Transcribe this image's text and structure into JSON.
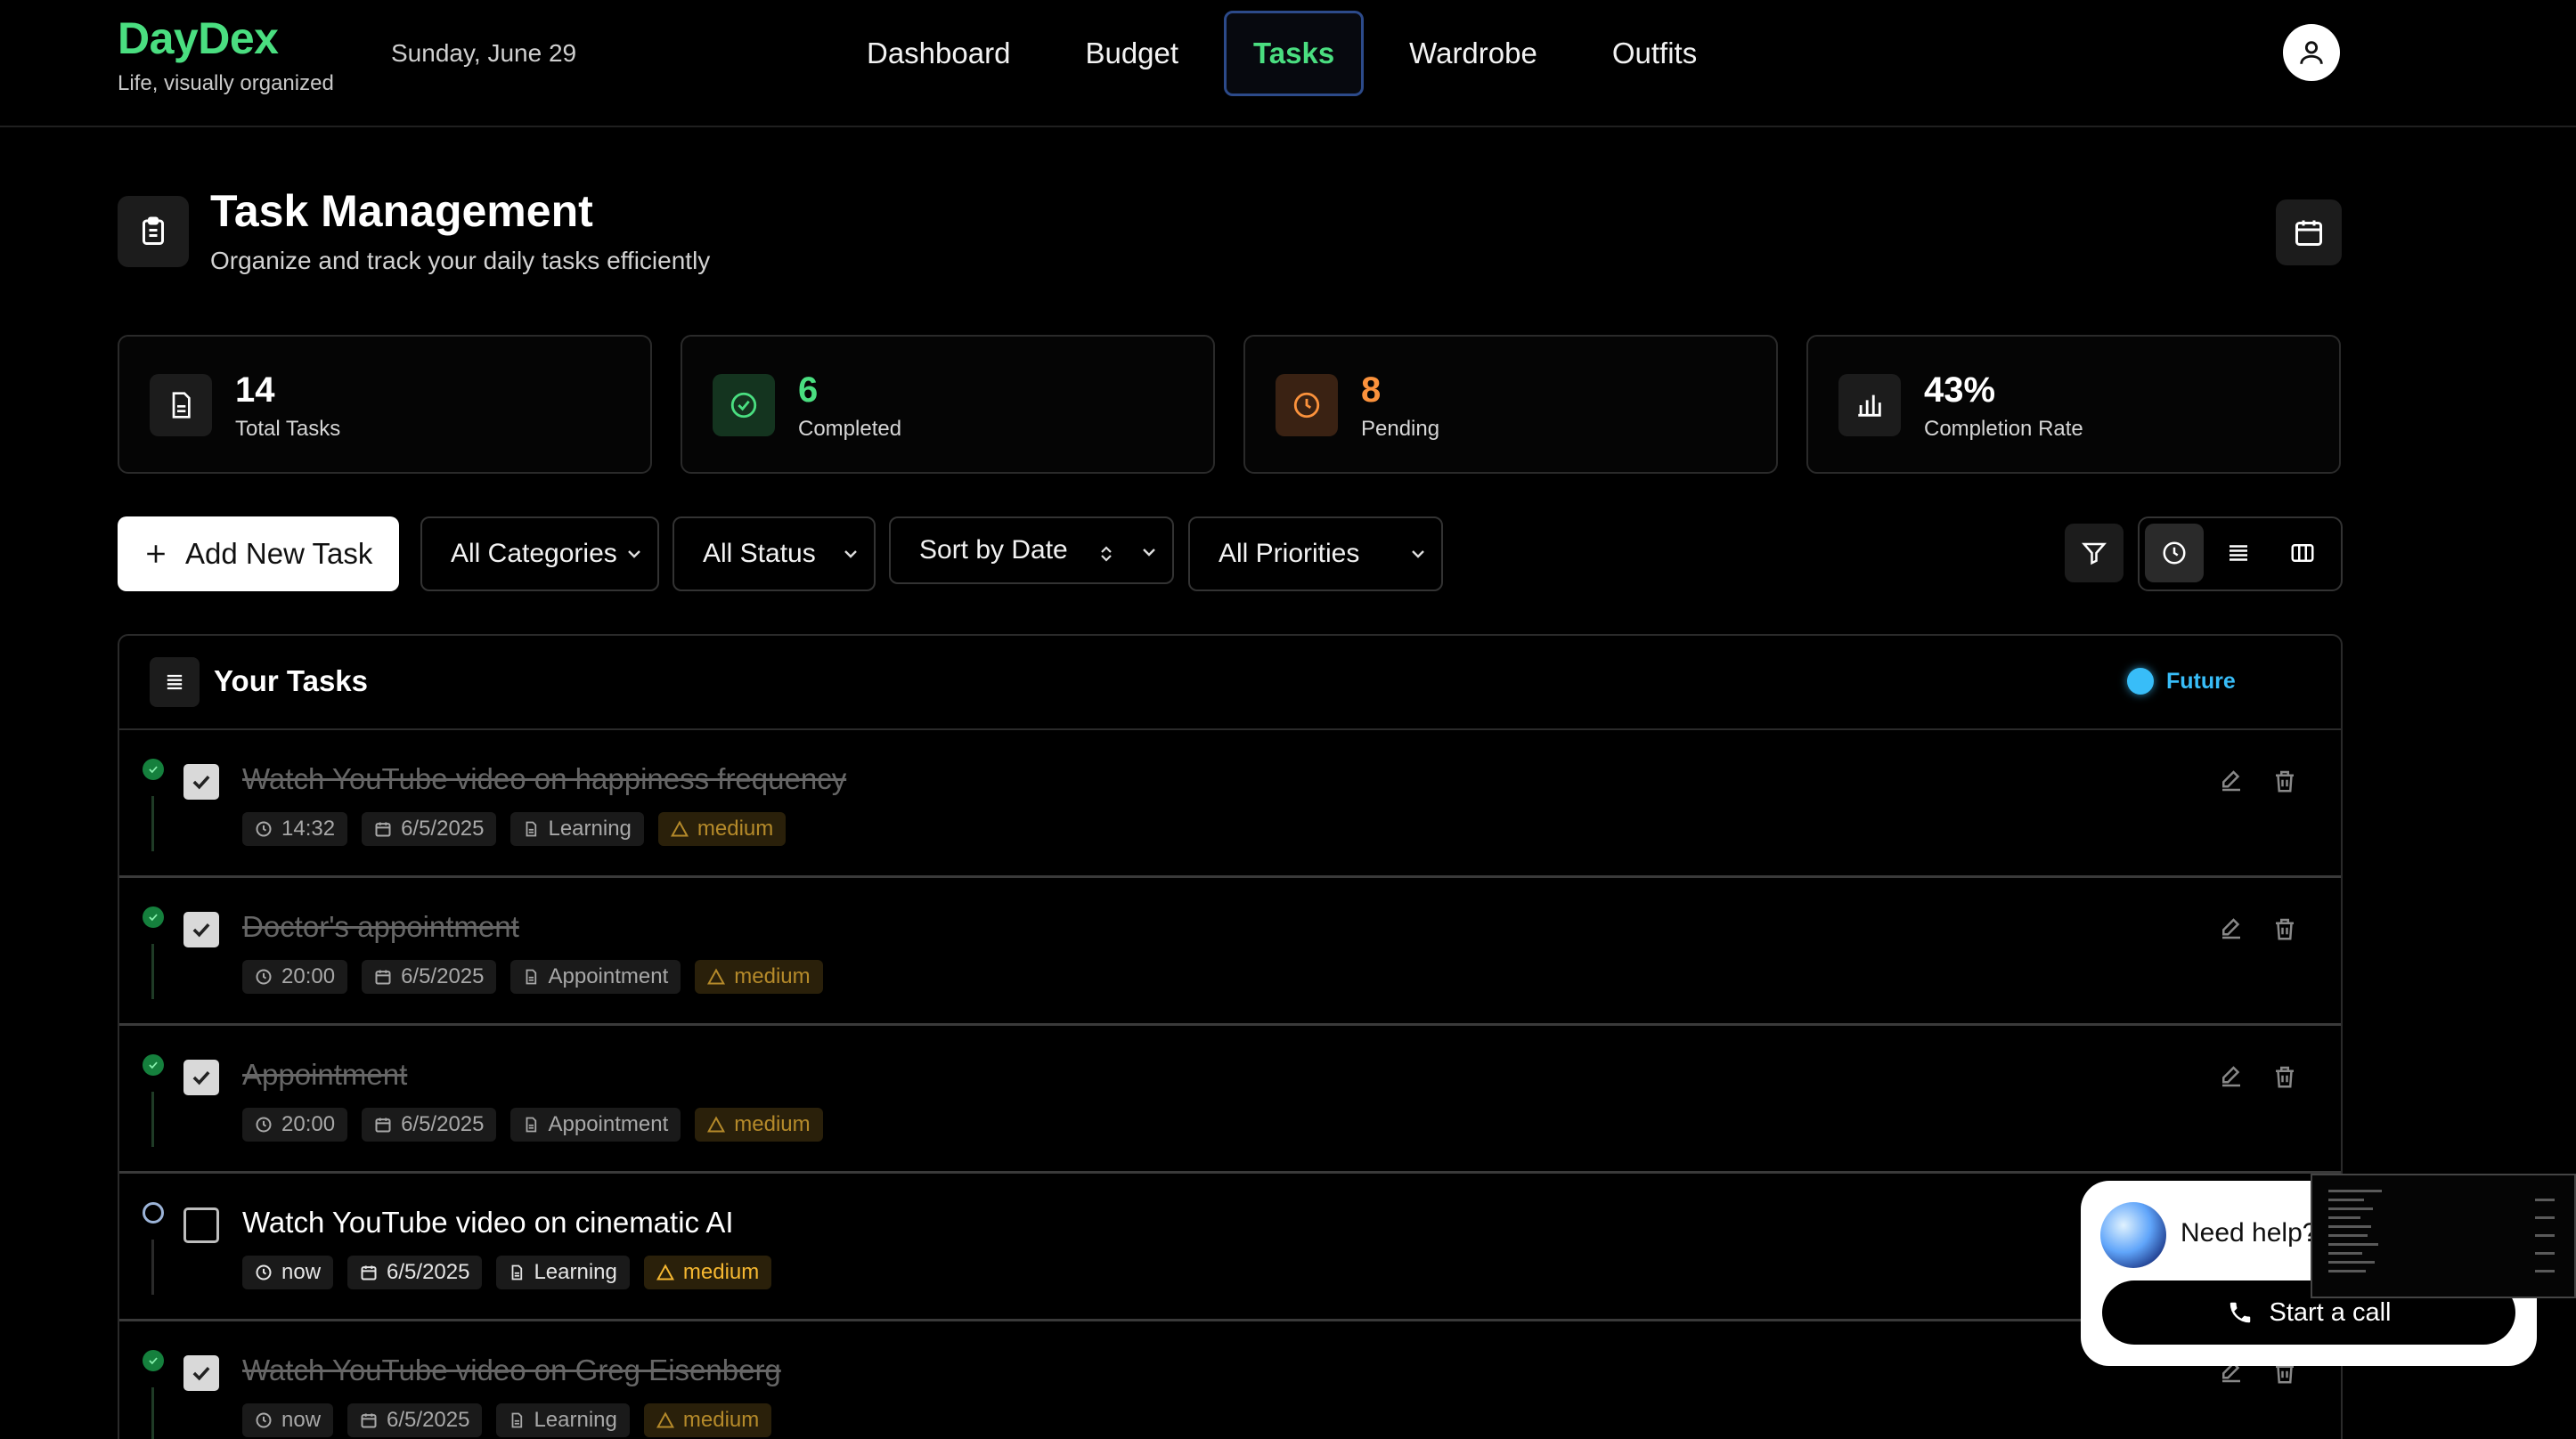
{
  "brand": {
    "name": "DayDex",
    "tagline": "Life, visually organized"
  },
  "date": "Sunday, June 29",
  "nav": {
    "items": [
      {
        "label": "Dashboard"
      },
      {
        "label": "Budget"
      },
      {
        "label": "Tasks",
        "active": true
      },
      {
        "label": "Wardrobe"
      },
      {
        "label": "Outfits"
      }
    ]
  },
  "page": {
    "title": "Task Management",
    "subtitle": "Organize and track your daily tasks efficiently"
  },
  "stats": [
    {
      "value": "14",
      "label": "Total Tasks",
      "icon": "file-icon",
      "color": "#ffffff"
    },
    {
      "value": "6",
      "label": "Completed",
      "icon": "check-circle-icon",
      "color": "#4ade80"
    },
    {
      "value": "8",
      "label": "Pending",
      "icon": "clock-icon",
      "color": "#fb923c"
    },
    {
      "value": "43%",
      "label": "Completion Rate",
      "icon": "bar-chart-icon",
      "color": "#ffffff"
    }
  ],
  "toolbar": {
    "add_label": "Add New Task",
    "category": "All Categories",
    "status": "All Status",
    "sort": "Sort by Date",
    "priority": "All Priorities"
  },
  "tasks_panel": {
    "title": "Your Tasks",
    "legend": "Future",
    "tasks": [
      {
        "title": "Watch YouTube video on happiness frequency",
        "time": "14:32",
        "date": "6/5/2025",
        "category": "Learning",
        "priority": "medium",
        "completed": true
      },
      {
        "title": "Doctor's appointment",
        "time": "20:00",
        "date": "6/5/2025",
        "category": "Appointment",
        "priority": "medium",
        "completed": true
      },
      {
        "title": "Appointment",
        "time": "20:00",
        "date": "6/5/2025",
        "category": "Appointment",
        "priority": "medium",
        "completed": true
      },
      {
        "title": "Watch YouTube video on cinematic AI",
        "time": "now",
        "date": "6/5/2025",
        "category": "Learning",
        "priority": "medium",
        "completed": false
      },
      {
        "title": "Watch YouTube video on Greg Eisenberg",
        "time": "now",
        "date": "6/5/2025",
        "category": "Learning",
        "priority": "medium",
        "completed": true
      }
    ]
  },
  "help": {
    "text": "Need help?",
    "call_label": "Start a call"
  },
  "colors": {
    "accent": "#4ade80",
    "pending": "#fb923c",
    "future": "#38bdf8",
    "priority": "#f5b731"
  }
}
